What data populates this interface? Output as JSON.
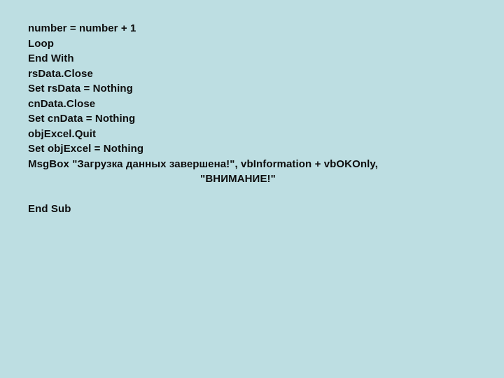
{
  "slide": {
    "background_color": "#bddee2",
    "text_color": "#0d0d0d",
    "code_lines": [
      {
        "text": "number = number + 1",
        "align": "left",
        "blank": false
      },
      {
        "text": "Loop",
        "align": "left",
        "blank": false
      },
      {
        "text": "End With",
        "align": "left",
        "blank": false
      },
      {
        "text": "rsData.Close",
        "align": "left",
        "blank": false
      },
      {
        "text": "Set rsData = Nothing",
        "align": "left",
        "blank": false
      },
      {
        "text": "cnData.Close",
        "align": "left",
        "blank": false
      },
      {
        "text": "Set cnData = Nothing",
        "align": "left",
        "blank": false
      },
      {
        "text": "objExcel.Quit",
        "align": "left",
        "blank": false
      },
      {
        "text": "Set objExcel = Nothing",
        "align": "left",
        "blank": false
      },
      {
        "text": "MsgBox \"Загрузка данных завершена!\", vbInformation + vbOKOnly,",
        "align": "left",
        "blank": false
      },
      {
        "text": "\"ВНИМАНИЕ!\"",
        "align": "center",
        "blank": false
      },
      {
        "text": "",
        "align": "left",
        "blank": true
      },
      {
        "text": "End Sub",
        "align": "left",
        "blank": false
      }
    ]
  }
}
